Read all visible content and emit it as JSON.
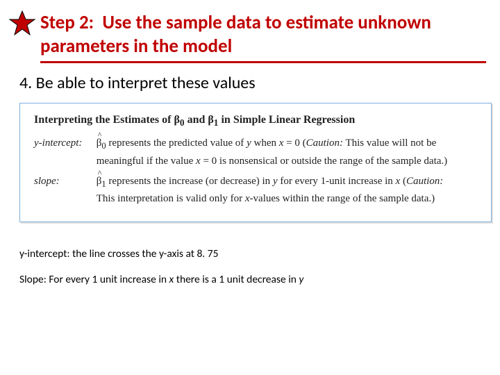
{
  "title": {
    "step_label": "Step 2:",
    "rest": "Use the sample data to estimate unknown parameters in the model"
  },
  "subpoint": "4.  Be able to interpret these values",
  "figure": {
    "heading_prefix": "Interpreting the Estimates of ",
    "beta0": "β",
    "beta0_sub": "0",
    "and": " and ",
    "beta1": "β",
    "beta1_sub": "1",
    "heading_suffix": " in Simple Linear Regression",
    "yint_label": "y-intercept:",
    "yint_sym_base": "β",
    "yint_sym_sub": "0",
    "yint_text_a": " represents the predicted value of ",
    "yint_y": "y",
    "yint_text_b": " when ",
    "yint_x": "x",
    "yint_text_c": " = 0 (",
    "yint_caution": "Caution:",
    "yint_text_d": " This value will not be meaningful if the value ",
    "yint_x2": "x",
    "yint_text_e": " = 0 is nonsensical or outside the range of the sample data.)",
    "slope_label": "slope:",
    "slope_sym_base": "β",
    "slope_sym_sub": "1",
    "slope_text_a": " represents the increase (or decrease) in ",
    "slope_y": "y",
    "slope_text_b": " for every 1-unit increase in ",
    "slope_x": "x",
    "slope_text_c": " (",
    "slope_caution": "Caution:",
    "slope_text_d": " This interpretation is valid only for ",
    "slope_x2": "x",
    "slope_text_e": "-values within the range of the sample data.)"
  },
  "notes": {
    "line1_a": "y-intercept:  the line crosses the y-axis at 8. 75",
    "line2_a": "Slope: For every 1 unit increase in ",
    "line2_x": "x",
    "line2_b": " there is a 1 unit decrease in ",
    "line2_y": "y"
  }
}
